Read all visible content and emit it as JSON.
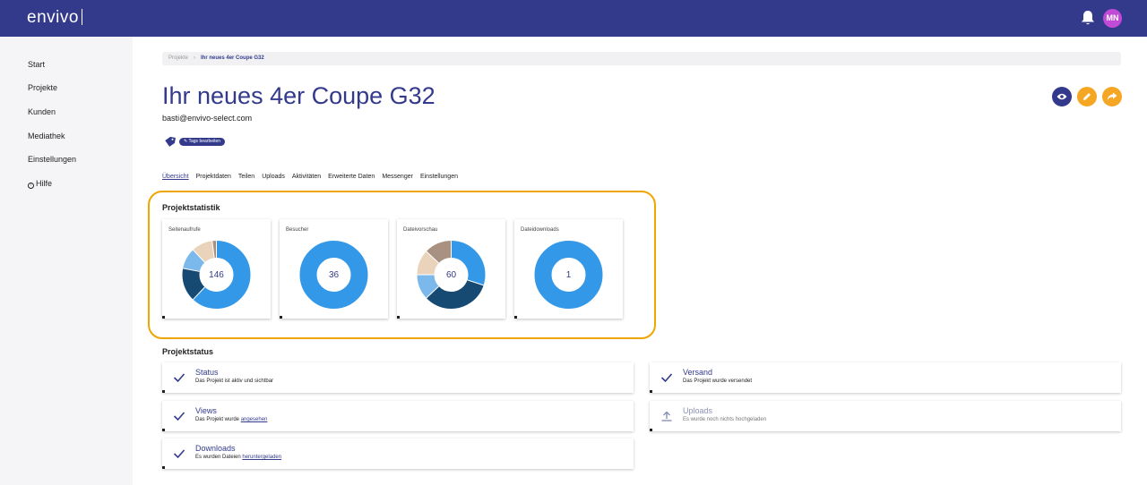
{
  "app": {
    "logo": "envivo",
    "avatar_initials": "MN"
  },
  "sidebar": {
    "items": [
      {
        "label": "Start"
      },
      {
        "label": "Projekte"
      },
      {
        "label": "Kunden"
      },
      {
        "label": "Mediathek"
      },
      {
        "label": "Einstellungen"
      },
      {
        "label": "Hilfe"
      }
    ]
  },
  "breadcrumb": {
    "parent": "Projekte",
    "current": "Ihr neues 4er Coupe G32"
  },
  "project": {
    "title": "Ihr neues 4er Coupe G32",
    "email": "basti@envivo-select.com",
    "tags_button": "Tags bearbeiten"
  },
  "tabs": [
    {
      "label": "Übersicht",
      "active": true
    },
    {
      "label": "Projektdaten"
    },
    {
      "label": "Teilen"
    },
    {
      "label": "Uploads"
    },
    {
      "label": "Aktivitäten"
    },
    {
      "label": "Erweiterte Daten"
    },
    {
      "label": "Messenger"
    },
    {
      "label": "Einstellungen"
    }
  ],
  "stats": {
    "heading": "Projektstatistik",
    "cards": [
      {
        "title": "Seitenaufrufe",
        "value": "146",
        "segments": [
          {
            "fraction": 0.62,
            "color": "#3498e8"
          },
          {
            "fraction": 0.16,
            "color": "#164a73"
          },
          {
            "fraction": 0.1,
            "color": "#7bb8ec"
          },
          {
            "fraction": 0.1,
            "color": "#e9d3ba"
          },
          {
            "fraction": 0.02,
            "color": "#a99182"
          }
        ]
      },
      {
        "title": "Besucher",
        "value": "36",
        "segments": [
          {
            "fraction": 1.0,
            "color": "#3498e8"
          }
        ]
      },
      {
        "title": "Dateivorschau",
        "value": "60",
        "segments": [
          {
            "fraction": 0.3,
            "color": "#3498e8"
          },
          {
            "fraction": 0.33,
            "color": "#164a73"
          },
          {
            "fraction": 0.12,
            "color": "#7bb8ec"
          },
          {
            "fraction": 0.12,
            "color": "#e9d3ba"
          },
          {
            "fraction": 0.13,
            "color": "#a99182"
          }
        ]
      },
      {
        "title": "Dateidownloads",
        "value": "1",
        "segments": [
          {
            "fraction": 1.0,
            "color": "#3498e8"
          }
        ]
      }
    ]
  },
  "status": {
    "heading": "Projektstatus",
    "items": [
      {
        "title": "Status",
        "desc": "Das Projekt ist aktiv und sichtbar",
        "icon": "check-icon"
      },
      {
        "title": "Versand",
        "desc": "Das Projekt wurde versendet",
        "icon": "check-icon"
      },
      {
        "title": "Views",
        "desc": "Das Projekt wurde ",
        "link": "angesehen",
        "icon": "check-icon"
      },
      {
        "title": "Uploads",
        "desc": "Es wurde noch nichts hochgeladen",
        "icon": "upload-icon"
      },
      {
        "title": "Downloads",
        "desc": "Es wurden Dateien ",
        "link": "heruntergeladen",
        "icon": "check-icon"
      }
    ]
  },
  "colors": {
    "brand": "#333a8c",
    "accent": "#f5a623",
    "highlight": "#f0a500",
    "avatar": "#c14bd6"
  }
}
